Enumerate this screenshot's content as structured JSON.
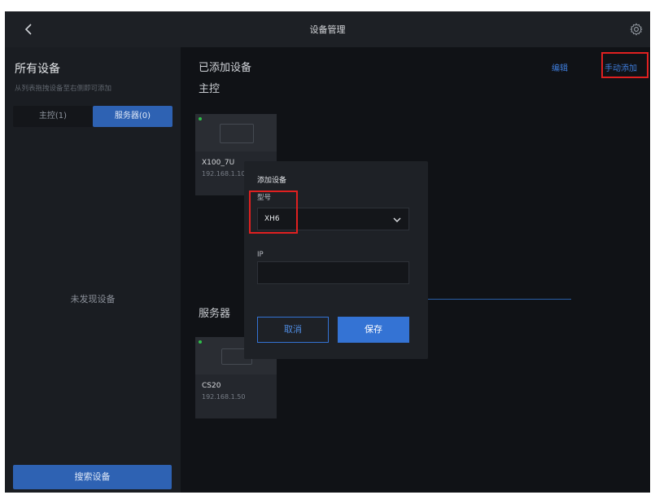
{
  "window": {
    "title": "设备管理"
  },
  "sidebar": {
    "heading": "所有设备",
    "hint": "从列表拖拽设备至右侧即可添加",
    "tabs": [
      "主控(1)",
      "服务器(0)"
    ],
    "empty_text": "未发现设备",
    "search_label": "搜索设备"
  },
  "main": {
    "heading": "已添加设备",
    "edit_label": "编辑",
    "manual_add_label": "手动添加",
    "sections": {
      "controllers": {
        "title": "主控",
        "devices": [
          {
            "name": "X100_7U",
            "ip": "192.168.1.10"
          }
        ]
      },
      "servers": {
        "title": "服务器",
        "devices": [
          {
            "name": "CS20",
            "ip": "192.168.1.50"
          }
        ]
      }
    }
  },
  "dialog": {
    "title": "添加设备",
    "model_label": "型号",
    "model_value": "XH6",
    "ip_label": "IP",
    "ip_value": "",
    "cancel_label": "取消",
    "save_label": "保存"
  },
  "colors": {
    "accent": "#3473d4",
    "highlight": "#e02020",
    "status_online": "#2fbf4a"
  }
}
